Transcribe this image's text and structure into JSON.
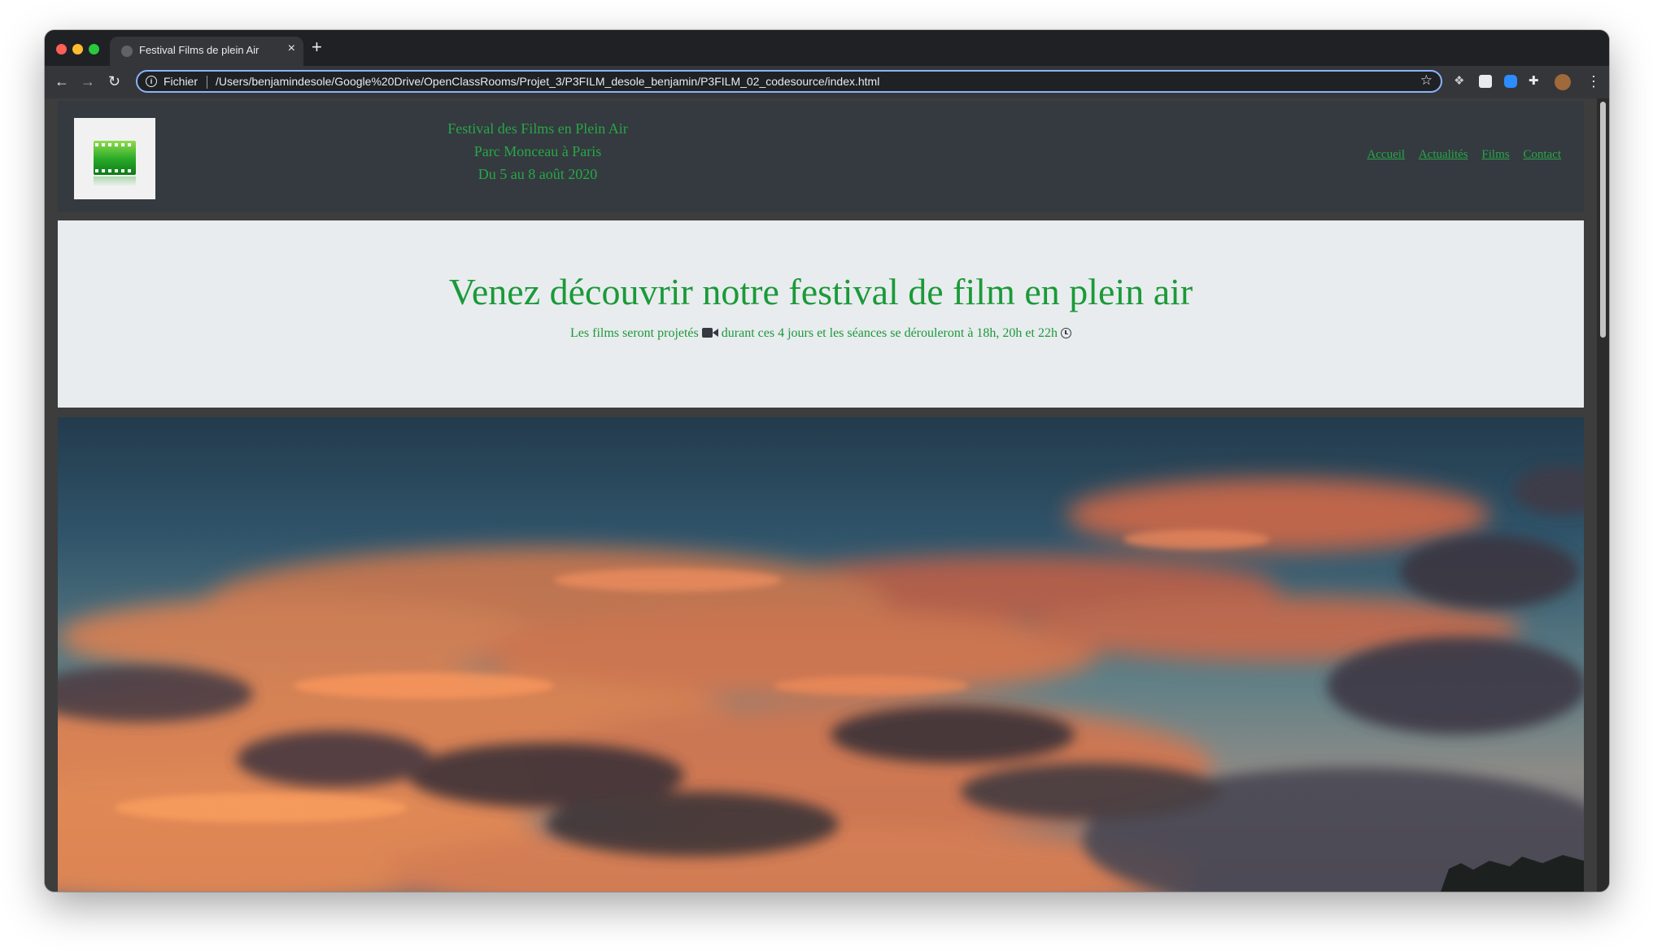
{
  "browser": {
    "tab_title": "Festival Films de plein Air",
    "tab_close": "×",
    "new_tab": "+",
    "nav": {
      "back": "←",
      "forward": "→",
      "reload": "↻"
    },
    "scheme_label": "Fichier",
    "url": "/Users/benjamindesole/Google%20Drive/OpenClassRooms/Projet_3/P3FILM_desole_benjamin/P3FILM_02_codesource/index.html",
    "star": "☆",
    "menu": "⋮",
    "extensions": [
      "dropbox-icon",
      "extension-g-icon",
      "zoom-icon",
      "puzzle-icon",
      "avatar"
    ]
  },
  "header": {
    "festival_line1": "Festival des Films en Plein Air",
    "festival_line2": "Parc Monceau à Paris",
    "festival_line3": "Du 5 au 8 août 2020",
    "nav": [
      "Accueil",
      "Actualités",
      "Films",
      "Contact"
    ]
  },
  "hero": {
    "title": "Venez découvrir notre festival de film en plein air",
    "sub_part1": "Les films seront projetés",
    "sub_part2": "durant ces 4 jours et les séances se dérouleront à 18h, 20h et 22h"
  },
  "colors": {
    "accent_green": "#28a745",
    "header_bg": "#343a40",
    "hero_bg": "#e9ecef",
    "browser_chrome": "#202124"
  }
}
